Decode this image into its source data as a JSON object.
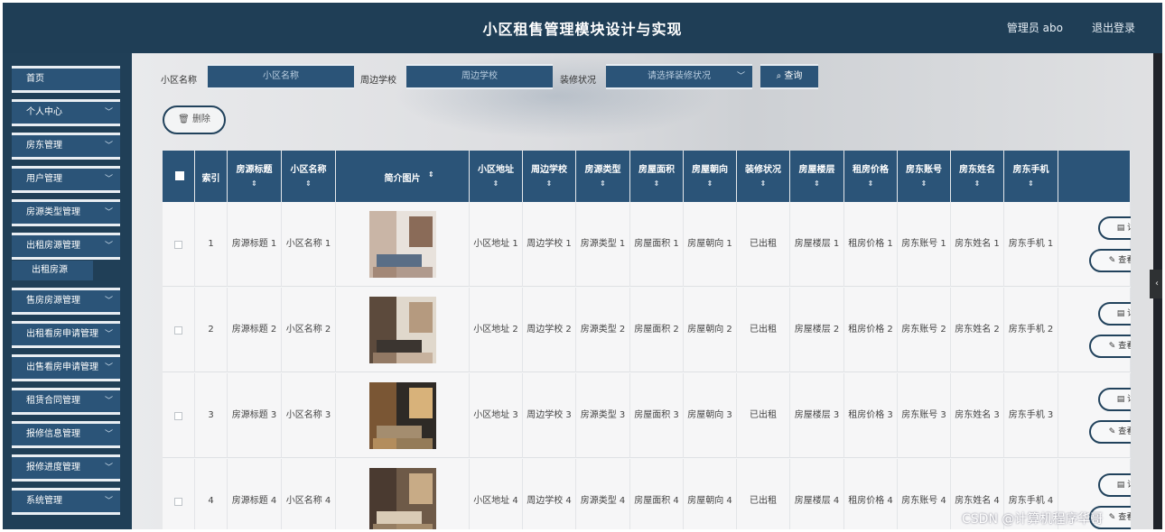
{
  "header": {
    "title": "小区租售管理模块设计与实现",
    "user": "管理员 abo",
    "logout": "退出登录"
  },
  "sidebar": {
    "items": [
      {
        "label": "首页",
        "chevron": false
      },
      {
        "label": "个人中心",
        "chevron": true
      },
      {
        "label": "房东管理",
        "chevron": true
      },
      {
        "label": "用户管理",
        "chevron": true
      },
      {
        "label": "房源类型管理",
        "chevron": true
      },
      {
        "label": "出租房源管理",
        "chevron": true
      },
      {
        "label": "售房房源管理",
        "chevron": true
      },
      {
        "label": "出租看房申请管理",
        "chevron": true
      },
      {
        "label": "出售看房申请管理",
        "chevron": true
      },
      {
        "label": "租赁合同管理",
        "chevron": true
      },
      {
        "label": "报修信息管理",
        "chevron": true
      },
      {
        "label": "报修进度管理",
        "chevron": true
      },
      {
        "label": "系统管理",
        "chevron": true
      }
    ],
    "sub_item": "出租房源"
  },
  "search": {
    "community_label": "小区名称",
    "community_placeholder": "小区名称",
    "school_label": "周边学校",
    "school_placeholder": "周边学校",
    "decor_label": "装修状况",
    "decor_placeholder": "请选择装修状况",
    "query_button": "查询"
  },
  "toolbar": {
    "delete_button": "删除"
  },
  "table": {
    "headers": [
      "索引",
      "房源标题",
      "小区名称",
      "简介图片",
      "小区地址",
      "周边学校",
      "房源类型",
      "房屋面积",
      "房屋朝向",
      "装修状况",
      "房屋楼层",
      "租房价格",
      "房东账号",
      "房东姓名",
      "房东手机"
    ],
    "sort_glyph": "⇕",
    "rows": [
      {
        "index": "1",
        "title": "房源标题 1",
        "community": "小区名称 1",
        "address": "小区地址 1",
        "school": "周边学校 1",
        "type": "房源类型 1",
        "area": "房屋面积 1",
        "orient": "房屋朝向 1",
        "decor": "已出租",
        "floor": "房屋楼层 1",
        "price": "租房价格 1",
        "account": "房东账号 1",
        "name": "房东姓名 1",
        "phone": "房东手机 1"
      },
      {
        "index": "2",
        "title": "房源标题 2",
        "community": "小区名称 2",
        "address": "小区地址 2",
        "school": "周边学校 2",
        "type": "房源类型 2",
        "area": "房屋面积 2",
        "orient": "房屋朝向 2",
        "decor": "已出租",
        "floor": "房屋楼层 2",
        "price": "租房价格 2",
        "account": "房东账号 2",
        "name": "房东姓名 2",
        "phone": "房东手机 2"
      },
      {
        "index": "3",
        "title": "房源标题 3",
        "community": "小区名称 3",
        "address": "小区地址 3",
        "school": "周边学校 3",
        "type": "房源类型 3",
        "area": "房屋面积 3",
        "orient": "房屋朝向 3",
        "decor": "已出租",
        "floor": "房屋楼层 3",
        "price": "租房价格 3",
        "account": "房东账号 3",
        "name": "房东姓名 3",
        "phone": "房东手机 3"
      },
      {
        "index": "4",
        "title": "房源标题 4",
        "community": "小区名称 4",
        "address": "小区地址 4",
        "school": "周边学校 4",
        "type": "房源类型 4",
        "area": "房屋面积 4",
        "orient": "房屋朝向 4",
        "decor": "已出租",
        "floor": "房屋楼层 4",
        "price": "租房价格 4",
        "account": "房东账号 4",
        "name": "房东姓名 4",
        "phone": "房东手机 4"
      }
    ],
    "actions": {
      "detail": "详",
      "view": "查看"
    }
  },
  "watermark": "CSDN @计算机程序华哥",
  "colors": {
    "primary": "#2b5478",
    "header": "#1f3e56",
    "border": "#21425c"
  }
}
